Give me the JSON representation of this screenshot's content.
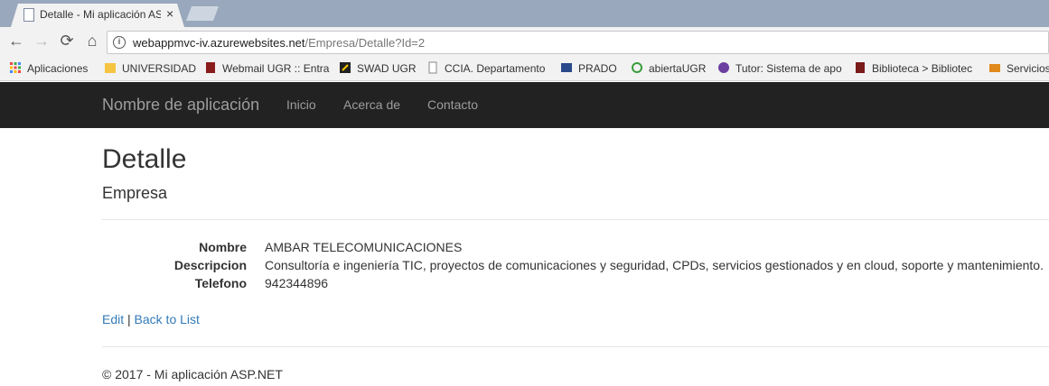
{
  "browser": {
    "tab_title": "Detalle - Mi aplicación ASP.NET",
    "tab_close": "×",
    "url_host": "webappmvc-iv.azurewebsites.net",
    "url_path": "/Empresa/Detalle?Id=2",
    "back": "←",
    "forward": "→",
    "reload": "⟳",
    "home": "⌂",
    "info": "i"
  },
  "bookmarks": [
    {
      "label": "Aplicaciones",
      "icon": "apps-grid-icon",
      "color": "#e44"
    },
    {
      "label": "UNIVERSIDAD",
      "icon": "folder-icon",
      "color": "#f5c542"
    },
    {
      "label": "Webmail UGR :: Entra",
      "icon": "webmail-icon",
      "color": "#8a1c1c"
    },
    {
      "label": "SWAD UGR",
      "icon": "swad-icon",
      "color": "#222"
    },
    {
      "label": "CCIA. Departamento",
      "icon": "ccia-icon",
      "color": "#888"
    },
    {
      "label": "PRADO",
      "icon": "prado-icon",
      "color": "#2b4a8c"
    },
    {
      "label": "abiertaUGR",
      "icon": "abierta-icon",
      "color": "#3a9d3a"
    },
    {
      "label": "Tutor: Sistema de apo",
      "icon": "tutor-icon",
      "color": "#6a3fa0"
    },
    {
      "label": "Biblioteca > Bibliotec",
      "icon": "biblioteca-icon",
      "color": "#7a1a1a"
    },
    {
      "label": "Servicios",
      "icon": "servicios-icon",
      "color": "#e08a1c"
    }
  ],
  "navbar": {
    "brand": "Nombre de aplicación",
    "links": [
      "Inicio",
      "Acerca de",
      "Contacto"
    ]
  },
  "page": {
    "title": "Detalle",
    "subtitle": "Empresa"
  },
  "details": [
    {
      "label": "Nombre",
      "value": "AMBAR TELECOMUNICACIONES"
    },
    {
      "label": "Descripcion",
      "value": "Consultoría e ingeniería TIC, proyectos de comunicaciones y seguridad, CPDs, servicios gestionados y en cloud, soporte y mantenimiento."
    },
    {
      "label": "Telefono",
      "value": "942344896"
    }
  ],
  "actions": {
    "edit": "Edit",
    "separator": "|",
    "back": "Back to List"
  },
  "footer": "© 2017 - Mi aplicación ASP.NET"
}
